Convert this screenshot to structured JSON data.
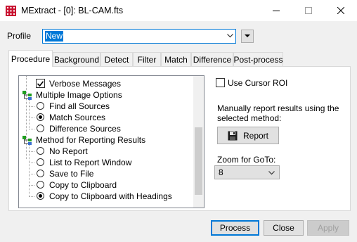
{
  "window": {
    "title": "MExtract - [0]: BL-CAM.fts",
    "minimize_icon": "minimize-icon",
    "maximize_icon": "maximize-icon",
    "close_icon": "close-icon"
  },
  "profile": {
    "label": "Profile",
    "value": "New"
  },
  "tabs": [
    {
      "label": "Procedure",
      "active": true
    },
    {
      "label": "Background"
    },
    {
      "label": "Detect"
    },
    {
      "label": "Filter"
    },
    {
      "label": "Match"
    },
    {
      "label": "Difference"
    },
    {
      "label": "Post-process"
    }
  ],
  "tree": {
    "items": [
      {
        "label": "Verbose Messages",
        "type": "checkbox",
        "checked": true
      },
      {
        "label": "Multiple Image Options",
        "type": "group"
      },
      {
        "label": "Find all Sources",
        "type": "radio",
        "checked": false
      },
      {
        "label": "Match Sources",
        "type": "radio",
        "checked": true
      },
      {
        "label": "Difference Sources",
        "type": "radio",
        "checked": false
      },
      {
        "label": "Method for Reporting Results",
        "type": "group"
      },
      {
        "label": "No Report",
        "type": "radio",
        "checked": false
      },
      {
        "label": "List to Report Window",
        "type": "radio",
        "checked": false
      },
      {
        "label": "Save to File",
        "type": "radio",
        "checked": false
      },
      {
        "label": "Copy to Clipboard",
        "type": "radio",
        "checked": false
      },
      {
        "label": "Copy to Clipboard with Headings",
        "type": "radio",
        "checked": true
      }
    ]
  },
  "right": {
    "cursor_roi_label": "Use Cursor ROI",
    "cursor_roi_checked": false,
    "manual_text_line1": "Manually report results using the",
    "manual_text_line2": "selected method:",
    "report_button": "Report",
    "zoom_label": "Zoom for GoTo:",
    "zoom_value": "8"
  },
  "buttons": {
    "process": "Process",
    "close": "Close",
    "apply": "Apply"
  },
  "colors": {
    "accent": "#0078d7",
    "group_icon_green": "#1f9e1f"
  }
}
